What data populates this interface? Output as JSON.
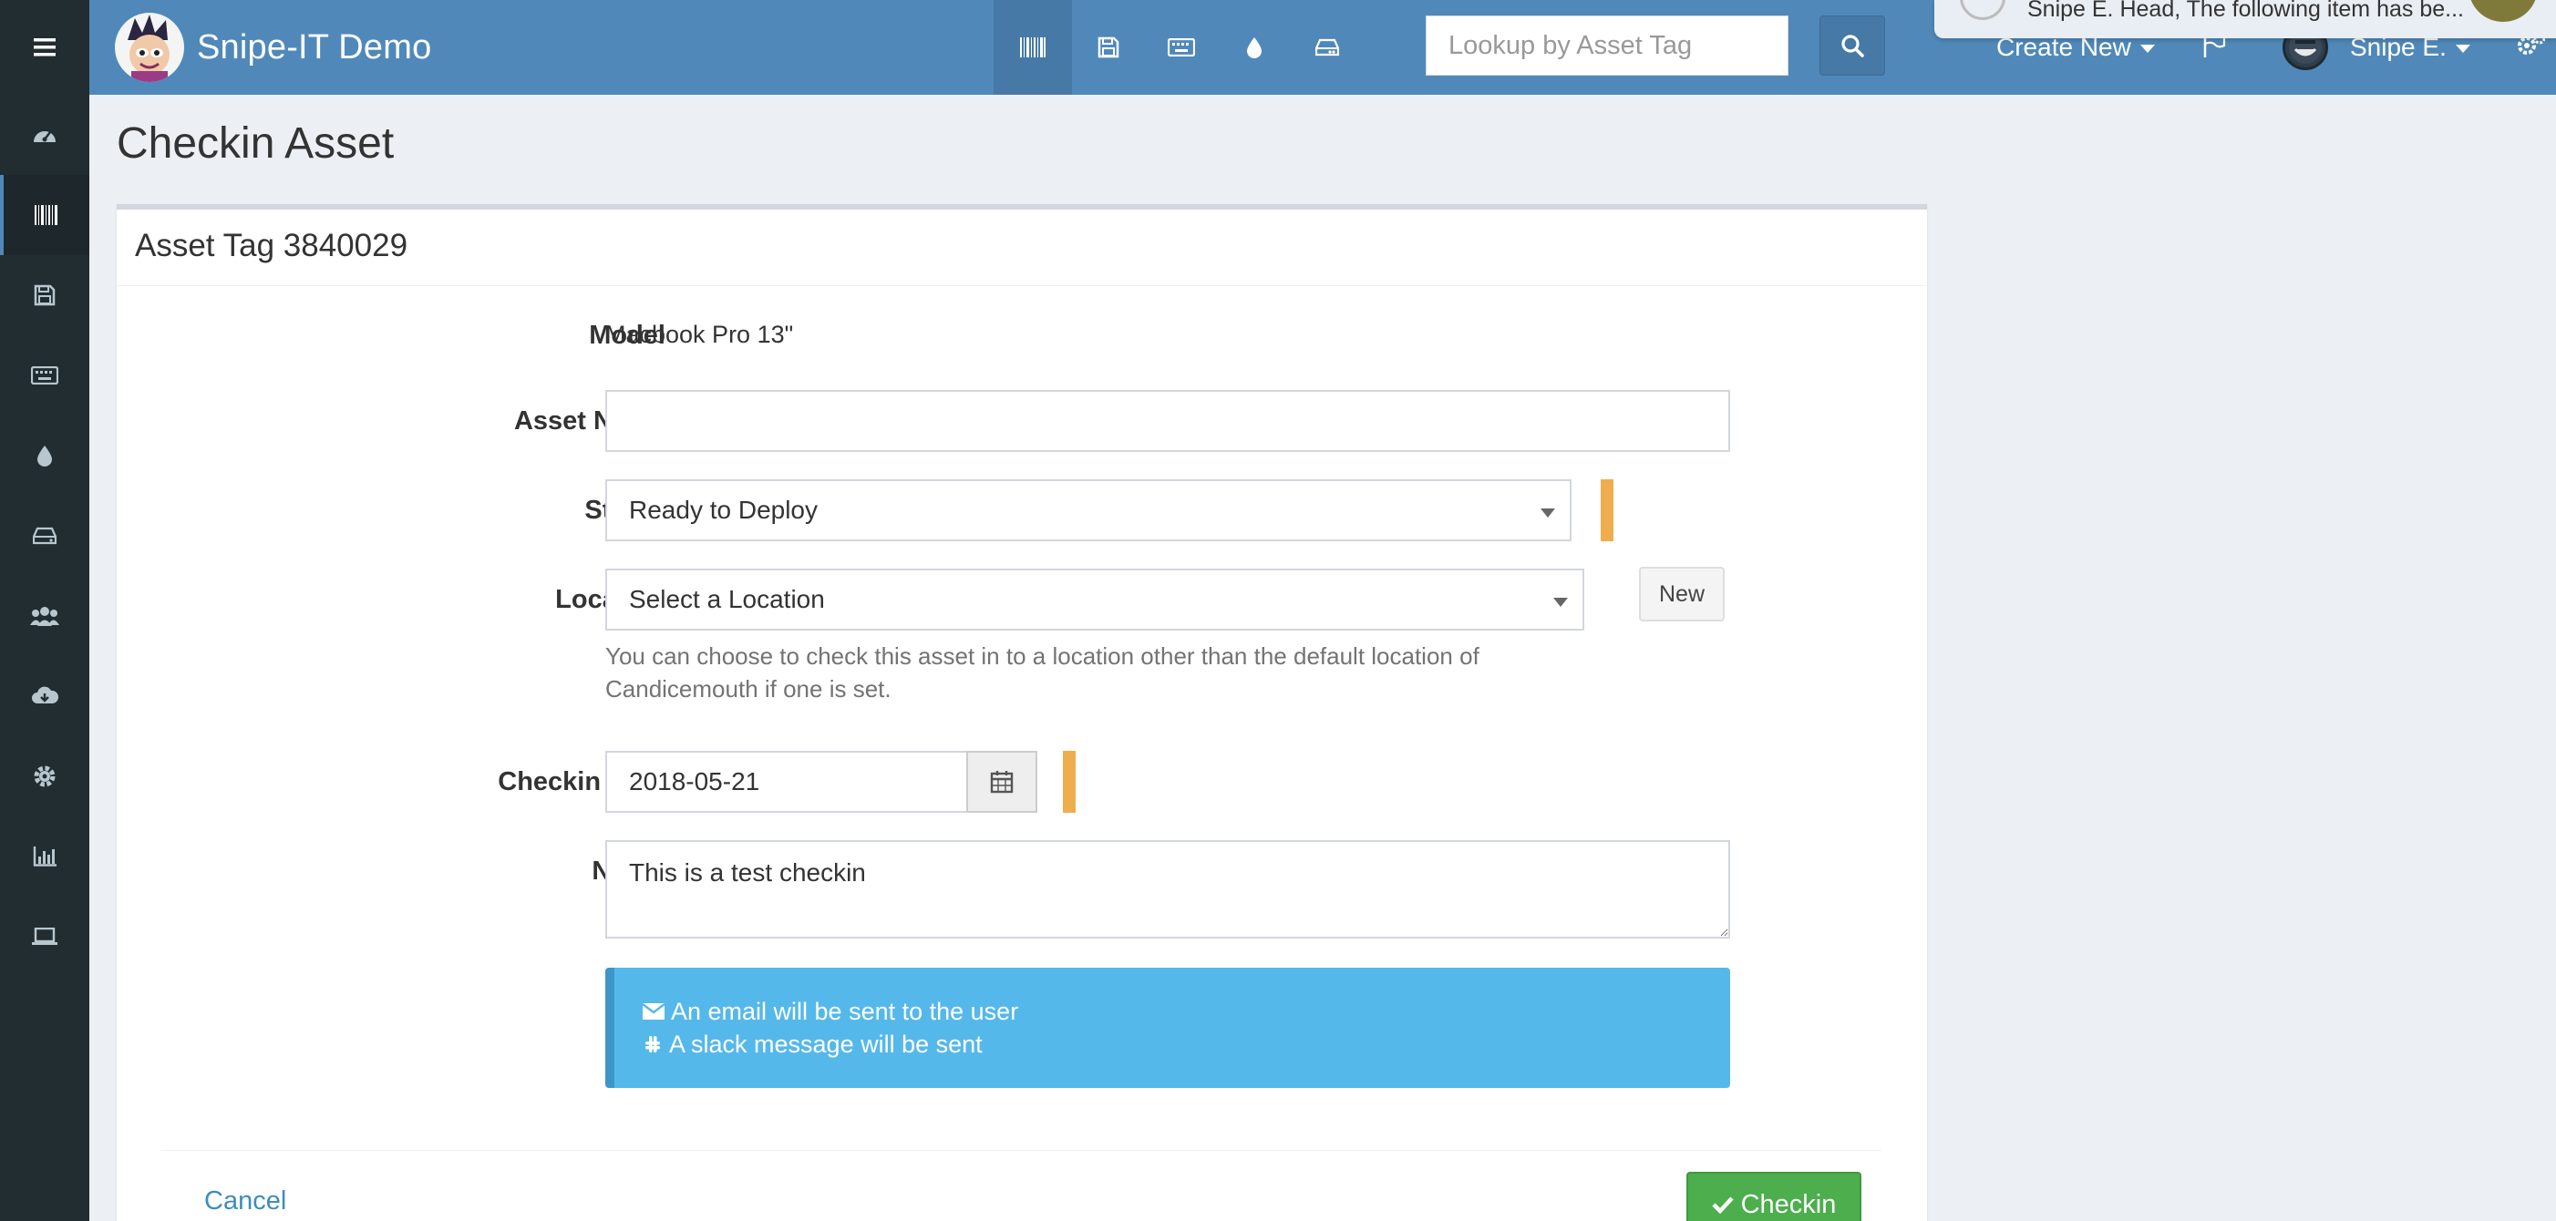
{
  "app": {
    "brand_title": "Snipe-IT Demo",
    "search_placeholder": "Lookup by Asset Tag",
    "create_new_label": "Create New",
    "user_label": "Snipe E."
  },
  "notification": {
    "text": "Snipe E. Head, The following item has be..."
  },
  "page": {
    "title": "Checkin Asset",
    "box_title": "Asset Tag 3840029"
  },
  "form": {
    "model_label": "Model",
    "model_value": "Macbook Pro 13\"",
    "asset_name_label": "Asset Name",
    "asset_name_value": "",
    "status_label": "Status",
    "status_value": "Ready to Deploy",
    "location_label": "Location",
    "location_value": "Select a Location",
    "location_new_button": "New",
    "location_help": "You can choose to check this asset in to a location other than the default location of Candicemouth if one is set.",
    "checkin_date_label": "Checkin Date",
    "checkin_date_value": "2018-05-21",
    "notes_label": "Notes",
    "notes_value": "This is a test checkin"
  },
  "callout": {
    "email_text": "An email will be sent to the user",
    "slack_text": "A slack message will be sent"
  },
  "actions": {
    "cancel_label": "Cancel",
    "checkin_label": "Checkin"
  },
  "colors": {
    "navbar": "#5089b9",
    "sidebar": "#222d32",
    "required_marker": "#f0ad4e",
    "callout": "#55b8ea",
    "success": "#4cae4c"
  }
}
